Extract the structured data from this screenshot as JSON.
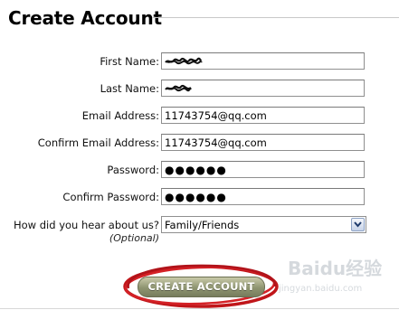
{
  "form": {
    "title": "Create Account",
    "fields": [
      {
        "label": "First Name:",
        "value": "",
        "redacted": true
      },
      {
        "label": "Last Name:",
        "value": "",
        "redacted": true
      },
      {
        "label": "Email Address:",
        "value": "11743754@qq.com"
      },
      {
        "label": "Confirm Email Address:",
        "value": "11743754@qq.com"
      },
      {
        "label": "Password:",
        "value": "●●●●●●"
      },
      {
        "label": "Confirm Password:",
        "value": "●●●●●●"
      }
    ],
    "referral": {
      "label": "How did you hear about us?",
      "sublabel": "(Optional)",
      "selected": "Family/Friends"
    },
    "submit_label": "CREATE ACCOUNT"
  },
  "watermark": {
    "text": "Baidu经验",
    "url": "jingyan.baidu.com"
  },
  "colors": {
    "highlight_ring": "#c0161a",
    "button_top": "#c9caa9",
    "button_bottom": "#777d5d"
  },
  "icons": {
    "select_arrow": "chevron-down-icon",
    "scribble": "redaction-scribble-icon"
  }
}
